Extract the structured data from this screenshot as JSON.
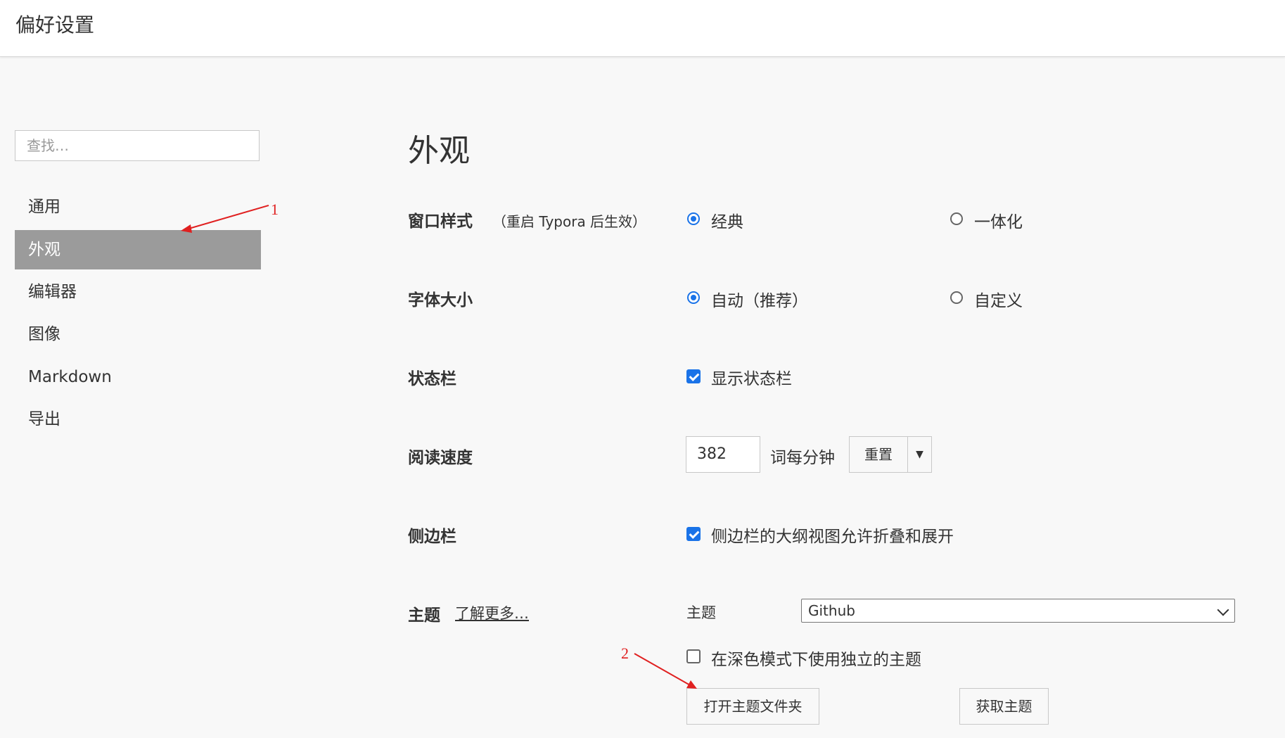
{
  "window": {
    "title": "偏好设置"
  },
  "sidebar": {
    "search_placeholder": "查找…",
    "items": [
      {
        "label": "通用"
      },
      {
        "label": "外观"
      },
      {
        "label": "编辑器"
      },
      {
        "label": "图像"
      },
      {
        "label": "Markdown"
      },
      {
        "label": "导出"
      }
    ],
    "active_index": 1
  },
  "main": {
    "section_title": "外观",
    "window_style": {
      "label": "窗口样式",
      "note": "（重启 Typora 后生效）",
      "options": [
        "经典",
        "一体化"
      ],
      "selected": "经典"
    },
    "font_size": {
      "label": "字体大小",
      "options": [
        "自动（推荐）",
        "自定义"
      ],
      "selected": "自动（推荐）"
    },
    "status_bar": {
      "label": "状态栏",
      "checkbox_label": "显示状态栏",
      "checked": true
    },
    "reading_speed": {
      "label": "阅读速度",
      "value": "382",
      "unit": "词每分钟",
      "reset_label": "重置",
      "dropdown_glyph": "▼"
    },
    "sidebar_setting": {
      "label": "侧边栏",
      "checkbox_label": "侧边栏的大纲视图允许折叠和展开",
      "checked": true
    },
    "theme": {
      "label": "主题",
      "learn_more": "了解更多…",
      "field_label": "主题",
      "selected": "Github",
      "dark_mode_label": "在深色模式下使用独立的主题",
      "dark_mode_checked": false,
      "open_folder_label": "打开主题文件夹",
      "get_theme_label": "获取主题"
    }
  },
  "annotations": {
    "one": "1",
    "two": "2",
    "color": "#e02020"
  },
  "colors": {
    "accent": "#1a73e8",
    "active_nav": "#9b9b9b"
  }
}
